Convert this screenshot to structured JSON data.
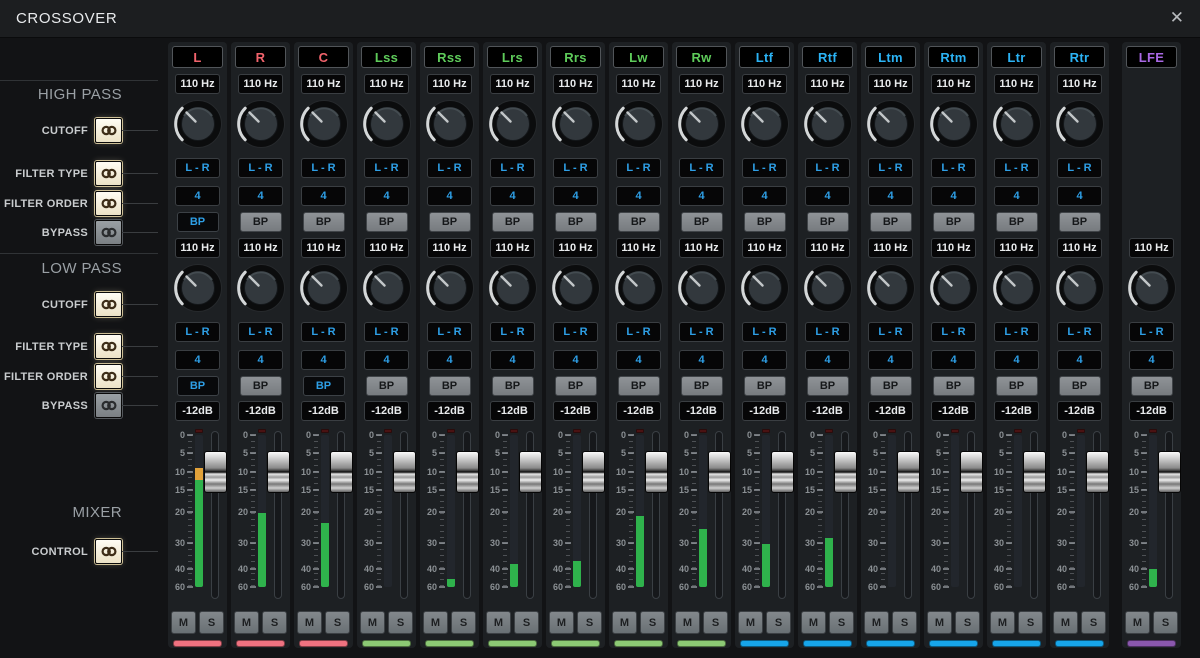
{
  "window": {
    "title": "CROSSOVER",
    "close": "✕"
  },
  "sidebar": {
    "high_pass": {
      "title": "HIGH PASS",
      "rows": [
        {
          "label": "CUTOFF",
          "linked": true
        },
        {
          "label": "FILTER TYPE",
          "linked": true
        },
        {
          "label": "FILTER ORDER",
          "linked": true
        },
        {
          "label": "BYPASS",
          "linked": false
        }
      ]
    },
    "low_pass": {
      "title": "LOW PASS",
      "rows": [
        {
          "label": "CUTOFF",
          "linked": true
        },
        {
          "label": "FILTER TYPE",
          "linked": true
        },
        {
          "label": "FILTER ORDER",
          "linked": true
        },
        {
          "label": "BYPASS",
          "linked": false
        }
      ]
    },
    "mixer": {
      "title": "MIXER",
      "rows": [
        {
          "label": "CONTROL",
          "linked": true
        }
      ]
    }
  },
  "strip_defaults": {
    "hp_cutoff": "110 Hz",
    "lp_cutoff": "110 Hz",
    "filter_type": "L - R",
    "filter_order": "4",
    "bypass": "BP",
    "gain": "-12dB",
    "mute": "M",
    "solo": "S",
    "meter_scale": [
      "0",
      "5",
      "10",
      "15",
      "20",
      "30",
      "40",
      "60"
    ],
    "meter_tick_fractions": [
      0,
      0.115,
      0.245,
      0.36,
      0.505,
      0.71,
      0.878,
      1
    ]
  },
  "colors": {
    "label_red": "#f2636c",
    "label_green": "#5ecb5a",
    "label_blue": "#2bb3f5",
    "label_purple": "#a968e4",
    "strip_red": "#ef7280",
    "strip_green": "#8cc974",
    "strip_blue": "#17a5ea",
    "strip_purple": "#8a57ad",
    "value_blue": "#2e9fe6",
    "meter_green": "#2fb24c",
    "meter_orange": "#e2a23a"
  },
  "channels": [
    {
      "name": "L",
      "group": "red",
      "has_hp": true,
      "hp_bp_active": true,
      "lp_bp_active": true,
      "meter_pct": 78,
      "peak_pct": 8
    },
    {
      "name": "R",
      "group": "red",
      "has_hp": true,
      "hp_bp_active": false,
      "lp_bp_active": false,
      "meter_pct": 49,
      "peak_pct": 0
    },
    {
      "name": "C",
      "group": "red",
      "has_hp": true,
      "hp_bp_active": false,
      "lp_bp_active": true,
      "meter_pct": 42,
      "peak_pct": 0
    },
    {
      "name": "Lss",
      "group": "green",
      "has_hp": true,
      "hp_bp_active": false,
      "lp_bp_active": false,
      "meter_pct": 0,
      "peak_pct": 0
    },
    {
      "name": "Rss",
      "group": "green",
      "has_hp": true,
      "hp_bp_active": false,
      "lp_bp_active": false,
      "meter_pct": 5,
      "peak_pct": 0
    },
    {
      "name": "Lrs",
      "group": "green",
      "has_hp": true,
      "hp_bp_active": false,
      "lp_bp_active": false,
      "meter_pct": 15,
      "peak_pct": 0
    },
    {
      "name": "Rrs",
      "group": "green",
      "has_hp": true,
      "hp_bp_active": false,
      "lp_bp_active": false,
      "meter_pct": 17,
      "peak_pct": 0
    },
    {
      "name": "Lw",
      "group": "green",
      "has_hp": true,
      "hp_bp_active": false,
      "lp_bp_active": false,
      "meter_pct": 47,
      "peak_pct": 0
    },
    {
      "name": "Rw",
      "group": "green",
      "has_hp": true,
      "hp_bp_active": false,
      "lp_bp_active": false,
      "meter_pct": 38,
      "peak_pct": 0
    },
    {
      "name": "Ltf",
      "group": "blue",
      "has_hp": true,
      "hp_bp_active": false,
      "lp_bp_active": false,
      "meter_pct": 28,
      "peak_pct": 0
    },
    {
      "name": "Rtf",
      "group": "blue",
      "has_hp": true,
      "hp_bp_active": false,
      "lp_bp_active": false,
      "meter_pct": 32,
      "peak_pct": 0
    },
    {
      "name": "Ltm",
      "group": "blue",
      "has_hp": true,
      "hp_bp_active": false,
      "lp_bp_active": false,
      "meter_pct": 0,
      "peak_pct": 0
    },
    {
      "name": "Rtm",
      "group": "blue",
      "has_hp": true,
      "hp_bp_active": false,
      "lp_bp_active": false,
      "meter_pct": 0,
      "peak_pct": 0
    },
    {
      "name": "Ltr",
      "group": "blue",
      "has_hp": true,
      "hp_bp_active": false,
      "lp_bp_active": false,
      "meter_pct": 0,
      "peak_pct": 0
    },
    {
      "name": "Rtr",
      "group": "blue",
      "has_hp": true,
      "hp_bp_active": false,
      "lp_bp_active": false,
      "meter_pct": 0,
      "peak_pct": 0
    },
    {
      "name": "LFE",
      "group": "purple",
      "has_hp": false,
      "hp_bp_active": false,
      "lp_bp_active": false,
      "meter_pct": 12,
      "peak_pct": 0,
      "separated": true
    }
  ]
}
